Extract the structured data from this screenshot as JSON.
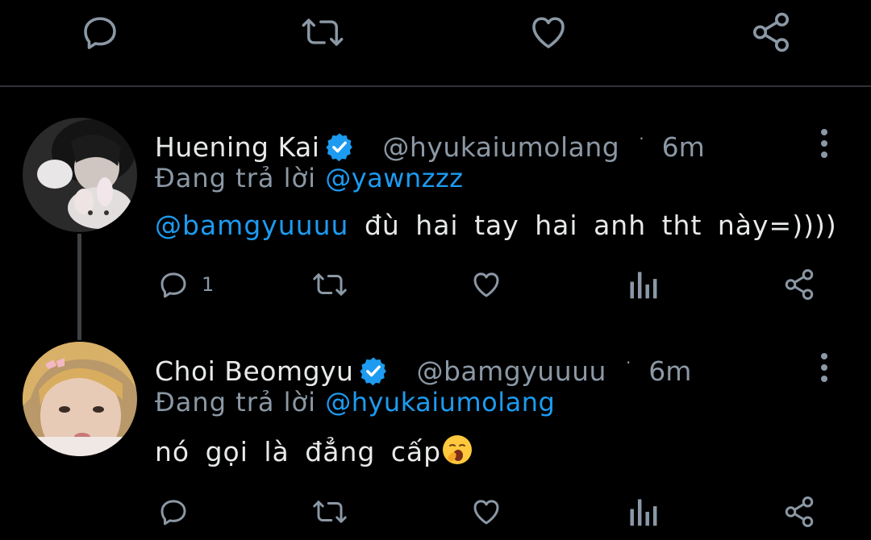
{
  "top_actions": {
    "reply_icon": "reply-icon",
    "retweet_icon": "retweet-icon",
    "like_icon": "heart-icon",
    "share_icon": "share-icon"
  },
  "tweets": [
    {
      "name": "Huening Kai",
      "handle": "@hyukaiumolang",
      "time": "6m",
      "reply_label": "Đang trả lời",
      "reply_to": "@yawnzzz",
      "mention": "@bamgyuuuu",
      "body": " đù hai tay hai anh tht này=))))",
      "reply_count": "1"
    },
    {
      "name": "Choi Beomgyu",
      "handle": "@bamgyuuuu",
      "time": "6m",
      "reply_label": "Đang trả lời",
      "reply_to": "@hyukaiumolang",
      "body": "nó gọi là đẳng cấp",
      "emoji": "yawning-face-emoji"
    }
  ],
  "colors": {
    "background": "#000000",
    "accent": "#1d9bf0",
    "muted": "#8b98a5",
    "text": "#e7e9ea"
  }
}
